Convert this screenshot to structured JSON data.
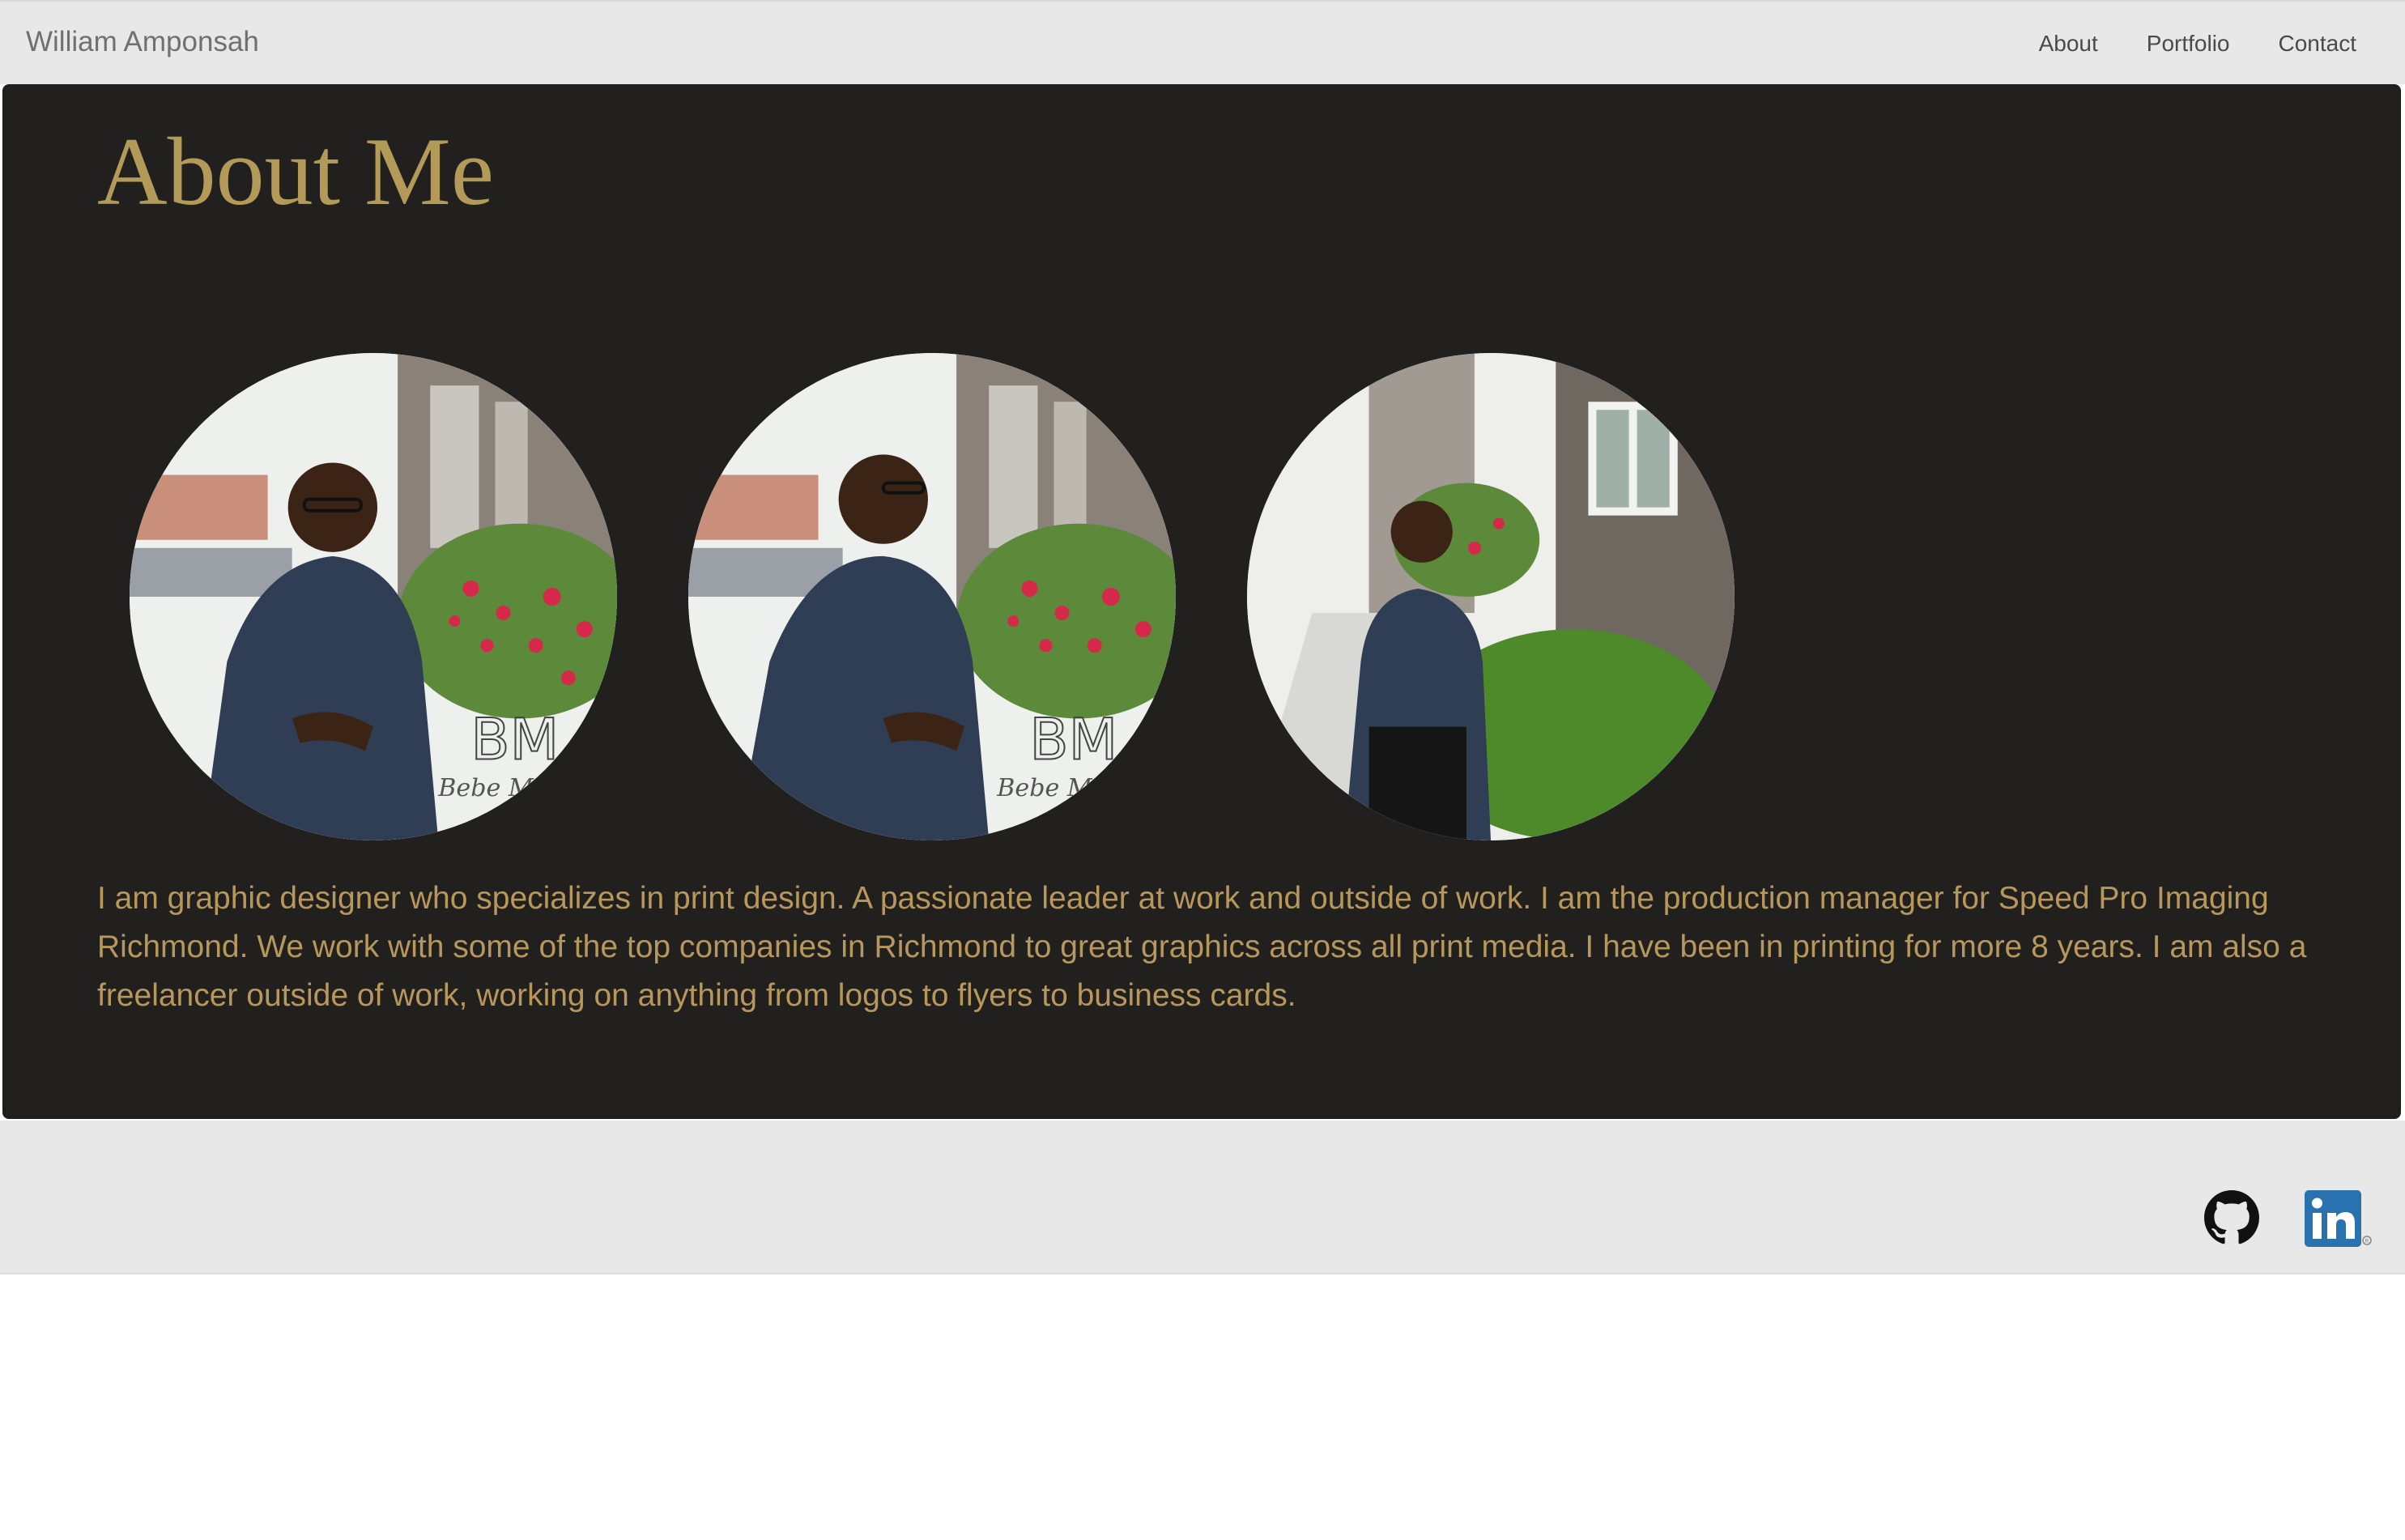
{
  "navbar": {
    "brand": "William Amponsah",
    "links": [
      {
        "label": "About"
      },
      {
        "label": "Portfolio"
      },
      {
        "label": "Contact"
      }
    ]
  },
  "about": {
    "title": "About Me",
    "photos": [
      {
        "icon": "portrait-photo-smiling",
        "watermark": "BM",
        "watermark_script": "Bebe Mo"
      },
      {
        "icon": "portrait-photo-looking-away",
        "watermark": "BM",
        "watermark_script": "Bebe Mo"
      },
      {
        "icon": "portrait-photo-walking"
      }
    ],
    "bio": "I am graphic designer who specializes in print design. A passionate leader at work and outside of work. I am the production manager for Speed Pro Imaging Richmond. We work with some of the top companies in Richmond to great graphics across all print media. I have been in printing for more 8 years. I am also a freelancer outside of work, working on anything from logos to flyers to business cards."
  },
  "footer": {
    "social": [
      {
        "icon": "github-icon"
      },
      {
        "icon": "linkedin-icon"
      }
    ]
  },
  "colors": {
    "accent_gold": "#b39a58",
    "panel_bg": "#22201f",
    "bar_bg": "#e8e8e8",
    "linkedin_blue": "#2a71b0"
  }
}
